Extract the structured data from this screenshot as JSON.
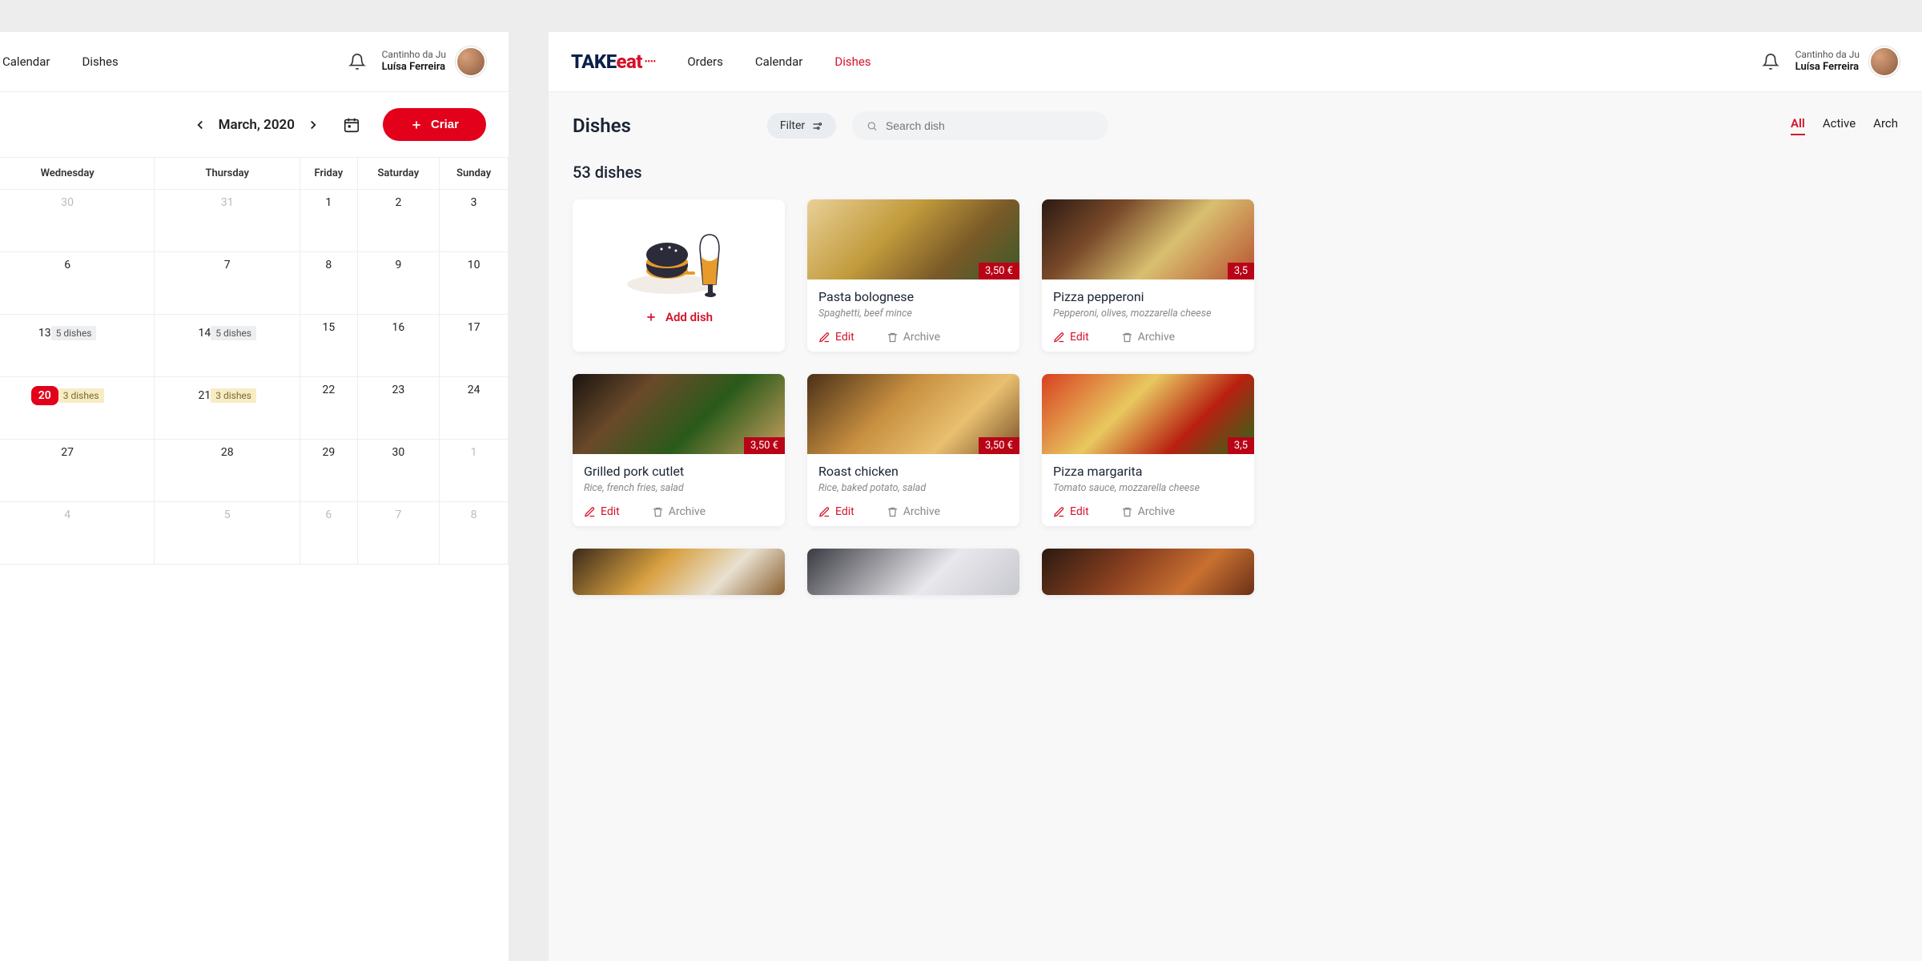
{
  "left": {
    "nav": {
      "calendar": "Calendar",
      "dishes": "Dishes"
    },
    "user": {
      "shop": "Cantinho da Ju",
      "name": "Luísa Ferreira"
    },
    "month": "March, 2020",
    "create": "Criar",
    "weekdays": [
      "Wednesday",
      "Thursday",
      "Friday",
      "Saturday",
      "Sunday"
    ],
    "cells": [
      {
        "n": "30",
        "dim": true
      },
      {
        "n": "31",
        "dim": true
      },
      {
        "n": "1"
      },
      {
        "n": "2"
      },
      {
        "n": "3"
      },
      {
        "n": "6"
      },
      {
        "n": "7"
      },
      {
        "n": "8"
      },
      {
        "n": "9"
      },
      {
        "n": "10"
      },
      {
        "n": "13",
        "badge": "5 dishes",
        "cls": "grey"
      },
      {
        "n": "14",
        "badge": "5 dishes",
        "cls": "grey"
      },
      {
        "n": "15"
      },
      {
        "n": "16"
      },
      {
        "n": "17"
      },
      {
        "n": "20",
        "today": true,
        "badge": "3 dishes",
        "cls": "yellow"
      },
      {
        "n": "21",
        "badge": "3 dishes",
        "cls": "yellow"
      },
      {
        "n": "22"
      },
      {
        "n": "23"
      },
      {
        "n": "24"
      },
      {
        "n": "27"
      },
      {
        "n": "28"
      },
      {
        "n": "29"
      },
      {
        "n": "30"
      },
      {
        "n": "1",
        "dim": true
      },
      {
        "n": "4",
        "dim": true
      },
      {
        "n": "5",
        "dim": true
      },
      {
        "n": "6",
        "dim": true
      },
      {
        "n": "7",
        "dim": true
      },
      {
        "n": "8",
        "dim": true
      }
    ]
  },
  "right": {
    "logo": {
      "take": "TAKE",
      "eat": "eat"
    },
    "nav": {
      "orders": "Orders",
      "calendar": "Calendar",
      "dishes": "Dishes"
    },
    "user": {
      "shop": "Cantinho da Ju",
      "name": "Luísa Ferreira"
    },
    "title": "Dishes",
    "filter": "Filter",
    "search_placeholder": "Search dish",
    "tabs": {
      "all": "All",
      "active": "Active",
      "archived": "Arch"
    },
    "count": "53 dishes",
    "add_dish": "Add dish",
    "action_edit": "Edit",
    "action_archive": "Archive",
    "dishes": [
      {
        "name": "Pasta bolognese",
        "desc": "Spaghetti, beef mince",
        "price": "3,50 €",
        "img": "food-pasta"
      },
      {
        "name": "Pizza pepperoni",
        "desc": "Pepperoni, olives, mozzarella cheese",
        "price": "3,5",
        "img": "food-pizza-pep"
      },
      {
        "name": "Grilled pork cutlet",
        "desc": "Rice, french fries, salad",
        "price": "3,50 €",
        "img": "food-pork"
      },
      {
        "name": "Roast chicken",
        "desc": "Rice, baked potato, salad",
        "price": "3,50 €",
        "img": "food-chicken"
      },
      {
        "name": "Pizza margarita",
        "desc": "Tomato sauce, mozzarella cheese",
        "price": "3,5",
        "img": "food-margarita"
      }
    ]
  }
}
